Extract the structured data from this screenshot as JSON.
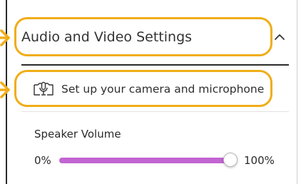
{
  "section": {
    "title": "Audio and Video Settings",
    "collapse_icon": "chevron-up-icon",
    "expanded": true
  },
  "setup": {
    "icon": "camera-microphone-icon",
    "label": "Set up your camera and microphone"
  },
  "volume": {
    "label": "Speaker Volume",
    "min_label": "0%",
    "max_label": "100%",
    "level": 1.0
  },
  "colors": {
    "highlight": "#f0ad17",
    "slider_fill": "#c265d2",
    "slider_track": "#d9d9d9",
    "rule": "#2b2b2b"
  }
}
